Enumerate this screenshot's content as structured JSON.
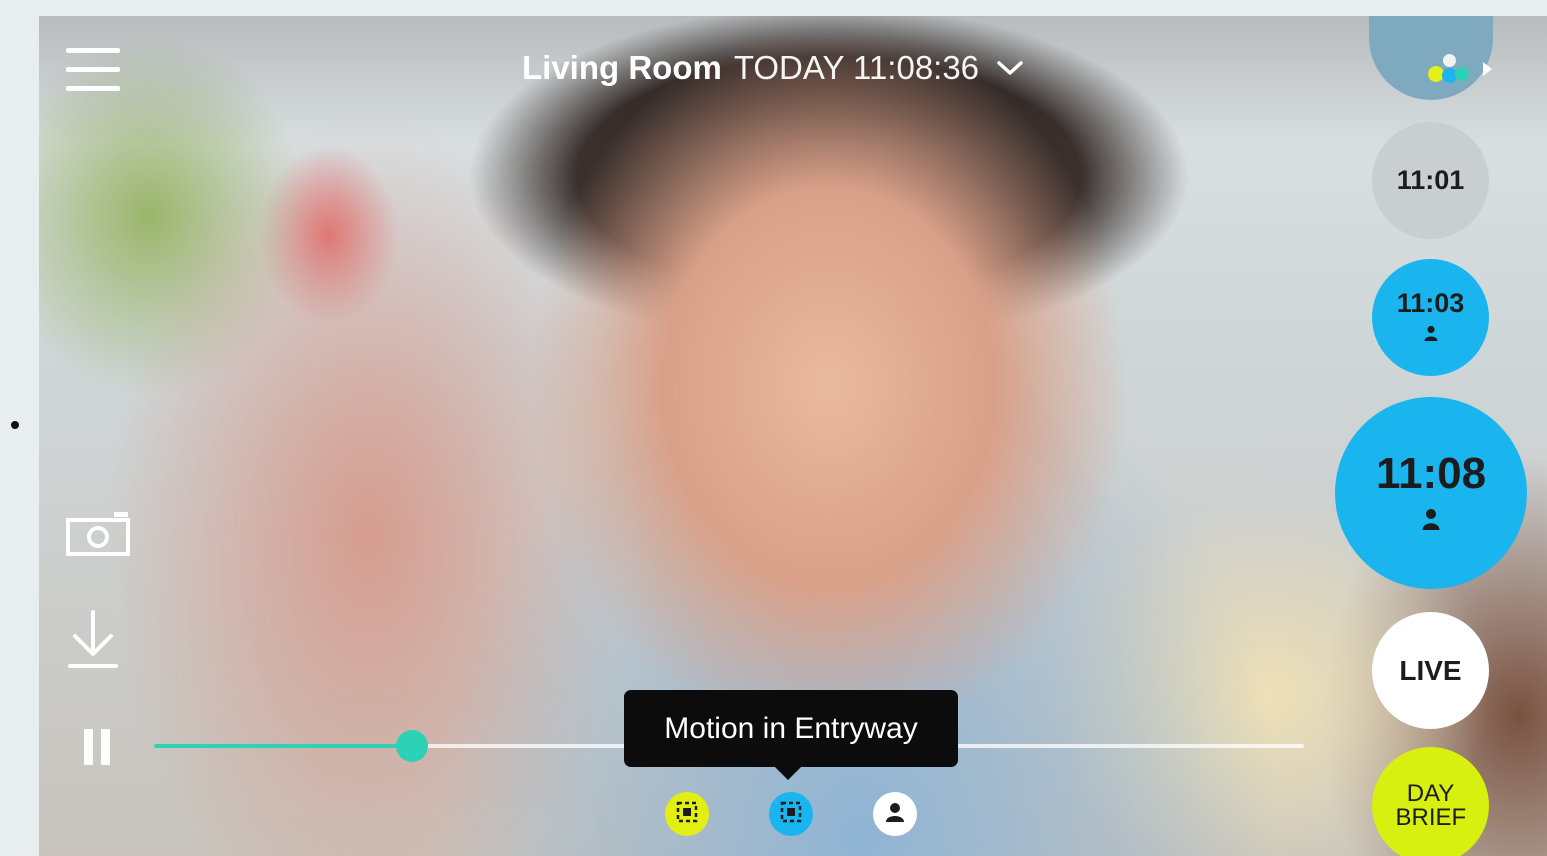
{
  "header": {
    "camera_name": "Living Room",
    "timestamp": "TODAY 11:08:36"
  },
  "timeline": {
    "clips": [
      {
        "time": "11:01",
        "color": "#c9ced1",
        "has_person": false
      },
      {
        "time": "11:03",
        "color": "#1ab5ee",
        "has_person": true
      },
      {
        "time": "11:08",
        "color": "#1ab5ee",
        "has_person": true,
        "selected": true
      }
    ],
    "live_label": "LIVE",
    "day_brief_label": "DAY BRIEF",
    "day_brief_color": "#d8f00f"
  },
  "player": {
    "progress": 0.22,
    "accent_color": "#2dd1b6",
    "state": "playing"
  },
  "event_tooltip": "Motion in Entryway",
  "events": [
    {
      "type": "motion-zone",
      "color": "#e3ef12"
    },
    {
      "type": "motion-zone",
      "color": "#1ab5ee"
    },
    {
      "type": "person",
      "color": "#ffffff"
    }
  ],
  "tools": [
    "snapshot",
    "download"
  ]
}
